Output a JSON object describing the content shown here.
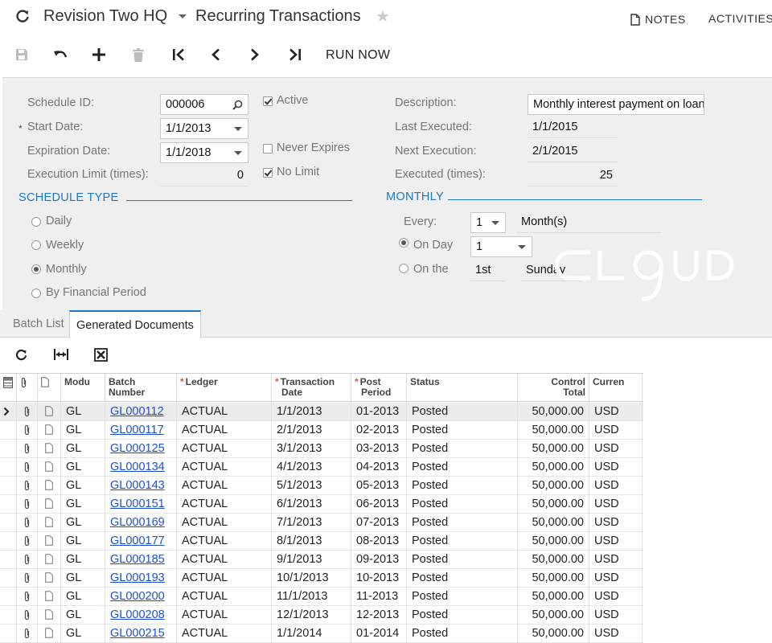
{
  "header": {
    "company": "Revision Two HQ",
    "screen_title": "Recurring Transactions",
    "notes_label": "NOTES",
    "activities_label": "ACTIVITIES"
  },
  "toolbar": {
    "run_now_label": "RUN NOW"
  },
  "form": {
    "schedule_id": {
      "label": "Schedule ID:",
      "value": "000006"
    },
    "start_date": {
      "label": "Start Date:",
      "value": "1/1/2013",
      "required_mark": "*"
    },
    "expiration_date": {
      "label": "Expiration Date:",
      "value": "1/1/2018"
    },
    "execution_limit": {
      "label": "Execution Limit (times):",
      "value": "0"
    },
    "active": {
      "label": "Active",
      "checked": true
    },
    "never_expires": {
      "label": "Never Expires",
      "checked": false
    },
    "no_limit": {
      "label": "No Limit",
      "checked": true
    },
    "description": {
      "label": "Description:",
      "value": "Monthly interest payment on loan"
    },
    "last_executed": {
      "label": "Last Executed:",
      "value": "1/1/2015"
    },
    "next_execution": {
      "label": "Next Execution:",
      "value": "2/1/2015"
    },
    "executed_times": {
      "label": "Executed (times):",
      "value": "25"
    }
  },
  "schedule_type": {
    "title": "SCHEDULE TYPE",
    "options": [
      "Daily",
      "Weekly",
      "Monthly",
      "By Financial Period"
    ],
    "selected": "Monthly"
  },
  "monthly": {
    "title": "MONTHLY",
    "every_label": "Every:",
    "every_value": "1",
    "every_unit": "Month(s)",
    "on_day_label": "On Day",
    "on_day_value": "1",
    "on_the_label": "On the",
    "on_the_ordinal": "1st",
    "on_the_weekday": "Sunday",
    "selected": "On Day"
  },
  "watermark_text": "CLOUD",
  "tabs": [
    {
      "label": "Batch List",
      "active": false
    },
    {
      "label": "Generated Documents",
      "active": true
    }
  ],
  "grid": {
    "columns": {
      "module": "Modu",
      "batch_number_1": "Batch",
      "batch_number_2": "Number",
      "ledger": "Ledger",
      "tran_date_1": "Transaction",
      "tran_date_2": "Date",
      "post_period_1": "Post",
      "post_period_2": "Period",
      "status": "Status",
      "control_total_1": "Control",
      "control_total_2": "Total",
      "currency": "Curren"
    },
    "required_mark": "*",
    "rows": [
      {
        "module": "GL",
        "batch": "GL000112",
        "ledger": "ACTUAL",
        "date": "1/1/2013",
        "period": "01-2013",
        "status": "Posted",
        "total": "50,000.00",
        "currency": "USD"
      },
      {
        "module": "GL",
        "batch": "GL000117",
        "ledger": "ACTUAL",
        "date": "2/1/2013",
        "period": "02-2013",
        "status": "Posted",
        "total": "50,000.00",
        "currency": "USD"
      },
      {
        "module": "GL",
        "batch": "GL000125",
        "ledger": "ACTUAL",
        "date": "3/1/2013",
        "period": "03-2013",
        "status": "Posted",
        "total": "50,000.00",
        "currency": "USD"
      },
      {
        "module": "GL",
        "batch": "GL000134",
        "ledger": "ACTUAL",
        "date": "4/1/2013",
        "period": "04-2013",
        "status": "Posted",
        "total": "50,000.00",
        "currency": "USD"
      },
      {
        "module": "GL",
        "batch": "GL000143",
        "ledger": "ACTUAL",
        "date": "5/1/2013",
        "period": "05-2013",
        "status": "Posted",
        "total": "50,000.00",
        "currency": "USD"
      },
      {
        "module": "GL",
        "batch": "GL000151",
        "ledger": "ACTUAL",
        "date": "6/1/2013",
        "period": "06-2013",
        "status": "Posted",
        "total": "50,000.00",
        "currency": "USD"
      },
      {
        "module": "GL",
        "batch": "GL000169",
        "ledger": "ACTUAL",
        "date": "7/1/2013",
        "period": "07-2013",
        "status": "Posted",
        "total": "50,000.00",
        "currency": "USD"
      },
      {
        "module": "GL",
        "batch": "GL000177",
        "ledger": "ACTUAL",
        "date": "8/1/2013",
        "period": "08-2013",
        "status": "Posted",
        "total": "50,000.00",
        "currency": "USD"
      },
      {
        "module": "GL",
        "batch": "GL000185",
        "ledger": "ACTUAL",
        "date": "9/1/2013",
        "period": "09-2013",
        "status": "Posted",
        "total": "50,000.00",
        "currency": "USD"
      },
      {
        "module": "GL",
        "batch": "GL000193",
        "ledger": "ACTUAL",
        "date": "10/1/2013",
        "period": "10-2013",
        "status": "Posted",
        "total": "50,000.00",
        "currency": "USD"
      },
      {
        "module": "GL",
        "batch": "GL000200",
        "ledger": "ACTUAL",
        "date": "11/1/2013",
        "period": "11-2013",
        "status": "Posted",
        "total": "50,000.00",
        "currency": "USD"
      },
      {
        "module": "GL",
        "batch": "GL000208",
        "ledger": "ACTUAL",
        "date": "12/1/2013",
        "period": "12-2013",
        "status": "Posted",
        "total": "50,000.00",
        "currency": "USD"
      },
      {
        "module": "GL",
        "batch": "GL000215",
        "ledger": "ACTUAL",
        "date": "1/1/2014",
        "period": "01-2014",
        "status": "Posted",
        "total": "50,000.00",
        "currency": "USD"
      }
    ]
  },
  "colors": {
    "accent": "#1a77c9",
    "link": "#1a4fd6",
    "form_bg": "#efefef",
    "required": "#d9534f"
  }
}
